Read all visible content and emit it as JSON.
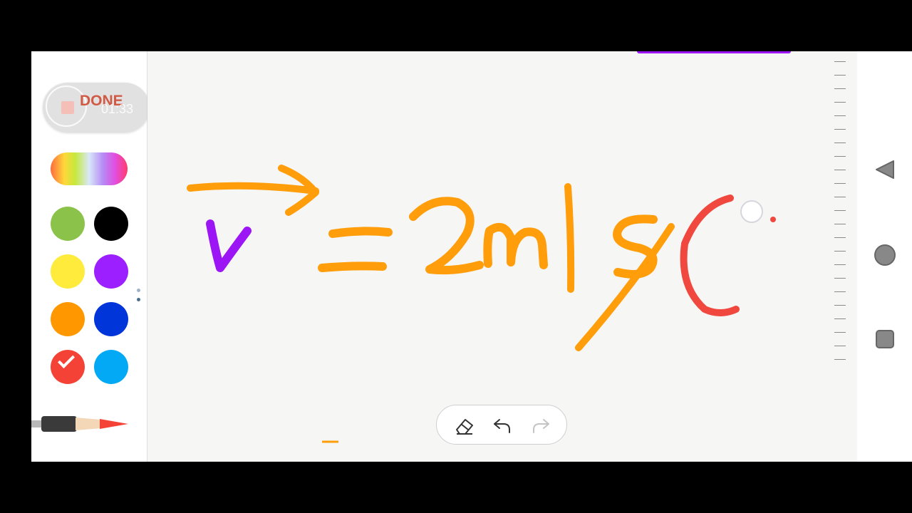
{
  "recorder": {
    "done_label": "DONE",
    "elapsed": "01:33"
  },
  "palette": {
    "spectrum_icon": "color-spectrum-icon",
    "swatches": [
      {
        "name": "green",
        "hex": "#8bc34a"
      },
      {
        "name": "black",
        "hex": "#000000"
      },
      {
        "name": "yellow",
        "hex": "#ffeb3b"
      },
      {
        "name": "purple",
        "hex": "#9c1fff"
      },
      {
        "name": "orange",
        "hex": "#ff9800"
      },
      {
        "name": "blue",
        "hex": "#0035d9"
      },
      {
        "name": "red",
        "hex": "#f44336",
        "selected": true
      },
      {
        "name": "light-blue",
        "hex": "#03a9f4"
      }
    ]
  },
  "pen": {
    "icon": "pen-icon",
    "selected_color": "#f44336"
  },
  "toolbar": {
    "eraser_icon": "eraser-icon",
    "undo_icon": "undo-icon",
    "redo_icon": "redo-icon",
    "redo_enabled": false
  },
  "navigation": {
    "back_icon": "back-triangle-icon",
    "home_icon": "home-circle-icon",
    "recents_icon": "recents-square-icon"
  },
  "colors": {
    "ink_orange": "#ff9d0a",
    "ink_purple": "#9b15f5",
    "ink_red": "#f0483e"
  }
}
